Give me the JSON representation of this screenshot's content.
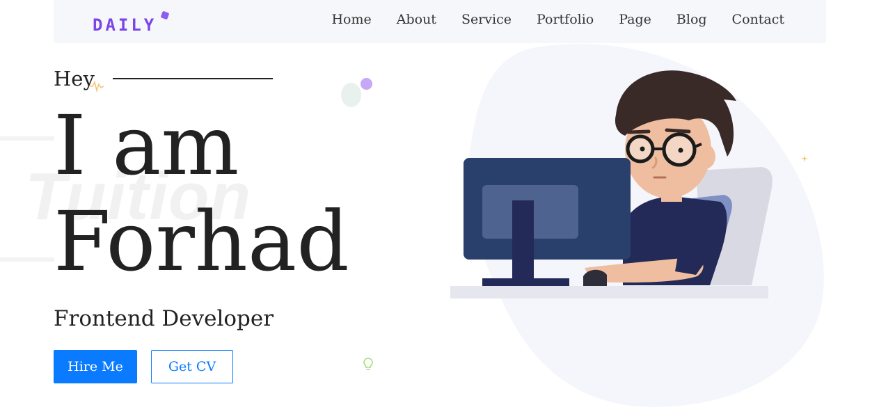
{
  "nav": {
    "logo": "DAILY",
    "links": [
      "Home",
      "About",
      "Service",
      "Portfolio",
      "Page",
      "Blog",
      "Contact"
    ]
  },
  "hero": {
    "greeting": "Hey",
    "line1": "I am",
    "line2": "Forhad",
    "background_word": "Tuition",
    "role": "Frontend Developer",
    "hire_label": "Hire Me",
    "cv_label": "Get CV"
  },
  "colors": {
    "accent": "#0a7aff",
    "logo": "#7b45e8",
    "blob": "#f5f6fb"
  }
}
